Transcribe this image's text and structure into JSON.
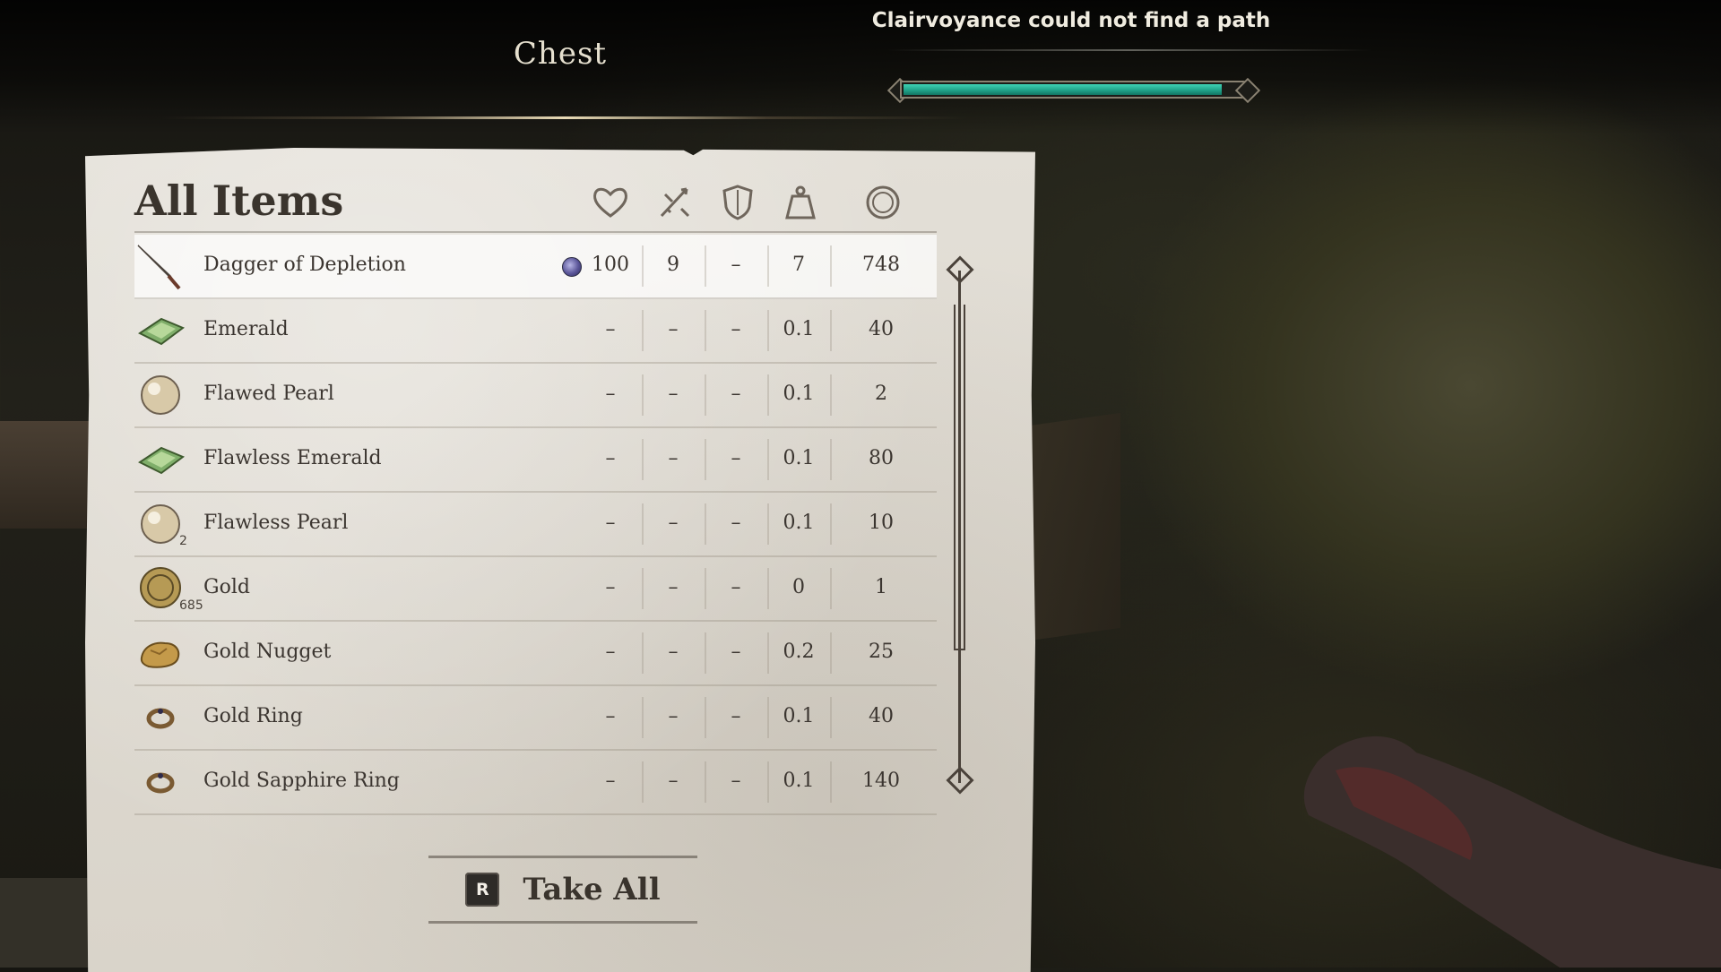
{
  "window": {
    "container_title": "Chest",
    "notification": "Clairvoyance could not find a path",
    "compass_bar": {
      "fill_fraction": 0.94,
      "color": "#2bbd9f"
    }
  },
  "inventory": {
    "section_title": "All Items",
    "columns": [
      {
        "icon": "heart-icon"
      },
      {
        "icon": "crossed-swords-icon"
      },
      {
        "icon": "shield-icon"
      },
      {
        "icon": "weight-icon"
      },
      {
        "icon": "coin-icon"
      }
    ],
    "rows": [
      {
        "name": "Dagger of Depletion",
        "icon": "dagger-icon",
        "qty": "",
        "enchanted": true,
        "c1": "100",
        "c2": "9",
        "c3": "–",
        "c4": "7",
        "c5": "748",
        "selected": true
      },
      {
        "name": "Emerald",
        "icon": "emerald-icon",
        "qty": "",
        "c1": "–",
        "c2": "–",
        "c3": "–",
        "c4": "0.1",
        "c5": "40"
      },
      {
        "name": "Flawed Pearl",
        "icon": "pearl-icon",
        "qty": "",
        "c1": "–",
        "c2": "–",
        "c3": "–",
        "c4": "0.1",
        "c5": "2"
      },
      {
        "name": "Flawless Emerald",
        "icon": "emerald-icon",
        "qty": "",
        "c1": "–",
        "c2": "–",
        "c3": "–",
        "c4": "0.1",
        "c5": "80"
      },
      {
        "name": "Flawless Pearl",
        "icon": "pearl-icon",
        "qty": "2",
        "c1": "–",
        "c2": "–",
        "c3": "–",
        "c4": "0.1",
        "c5": "10"
      },
      {
        "name": "Gold",
        "icon": "gold-coin-icon",
        "qty": "685",
        "c1": "–",
        "c2": "–",
        "c3": "–",
        "c4": "0",
        "c5": "1"
      },
      {
        "name": "Gold Nugget",
        "icon": "gold-nugget-icon",
        "qty": "",
        "c1": "–",
        "c2": "–",
        "c3": "–",
        "c4": "0.2",
        "c5": "25"
      },
      {
        "name": "Gold Ring",
        "icon": "ring-icon",
        "qty": "",
        "c1": "–",
        "c2": "–",
        "c3": "–",
        "c4": "0.1",
        "c5": "40"
      },
      {
        "name": "Gold Sapphire Ring",
        "icon": "ring-icon",
        "qty": "",
        "c1": "–",
        "c2": "–",
        "c3": "–",
        "c4": "0.1",
        "c5": "140"
      }
    ],
    "take_all": {
      "key": "R",
      "label": "Take All"
    }
  },
  "colors": {
    "paper": "#e0dcd4",
    "ink": "#3a342d",
    "accent": "#2bbd9f"
  }
}
